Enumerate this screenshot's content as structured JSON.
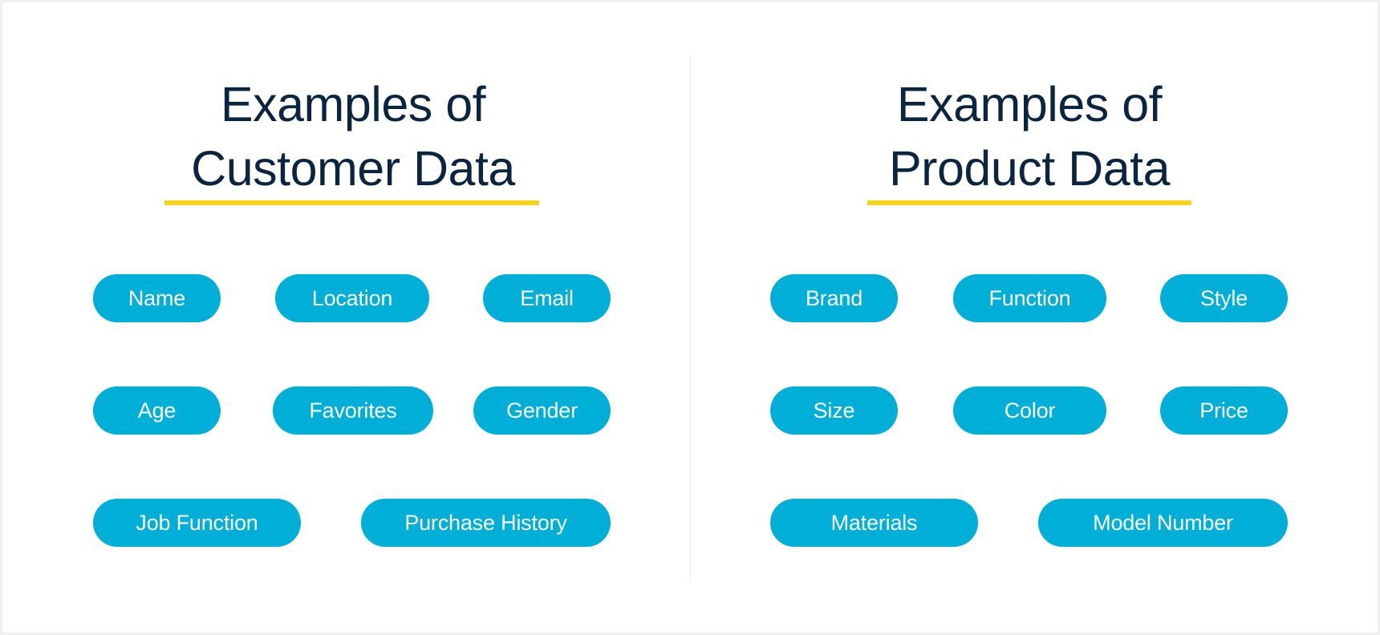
{
  "colors": {
    "title": "#0b2540",
    "accent_underline": "#f7d417",
    "pill_background": "#00afd8",
    "pill_text": "#ffffff"
  },
  "customer": {
    "title_line1": "Examples of",
    "title_line2": "Customer Data",
    "items": [
      "Name",
      "Location",
      "Email",
      "Age",
      "Favorites",
      "Gender",
      "Job Function",
      "Purchase History"
    ]
  },
  "product": {
    "title_line1": "Examples of",
    "title_line2": "Product Data",
    "items": [
      "Brand",
      "Function",
      "Style",
      "Size",
      "Color",
      "Price",
      "Materials",
      "Model Number"
    ]
  }
}
